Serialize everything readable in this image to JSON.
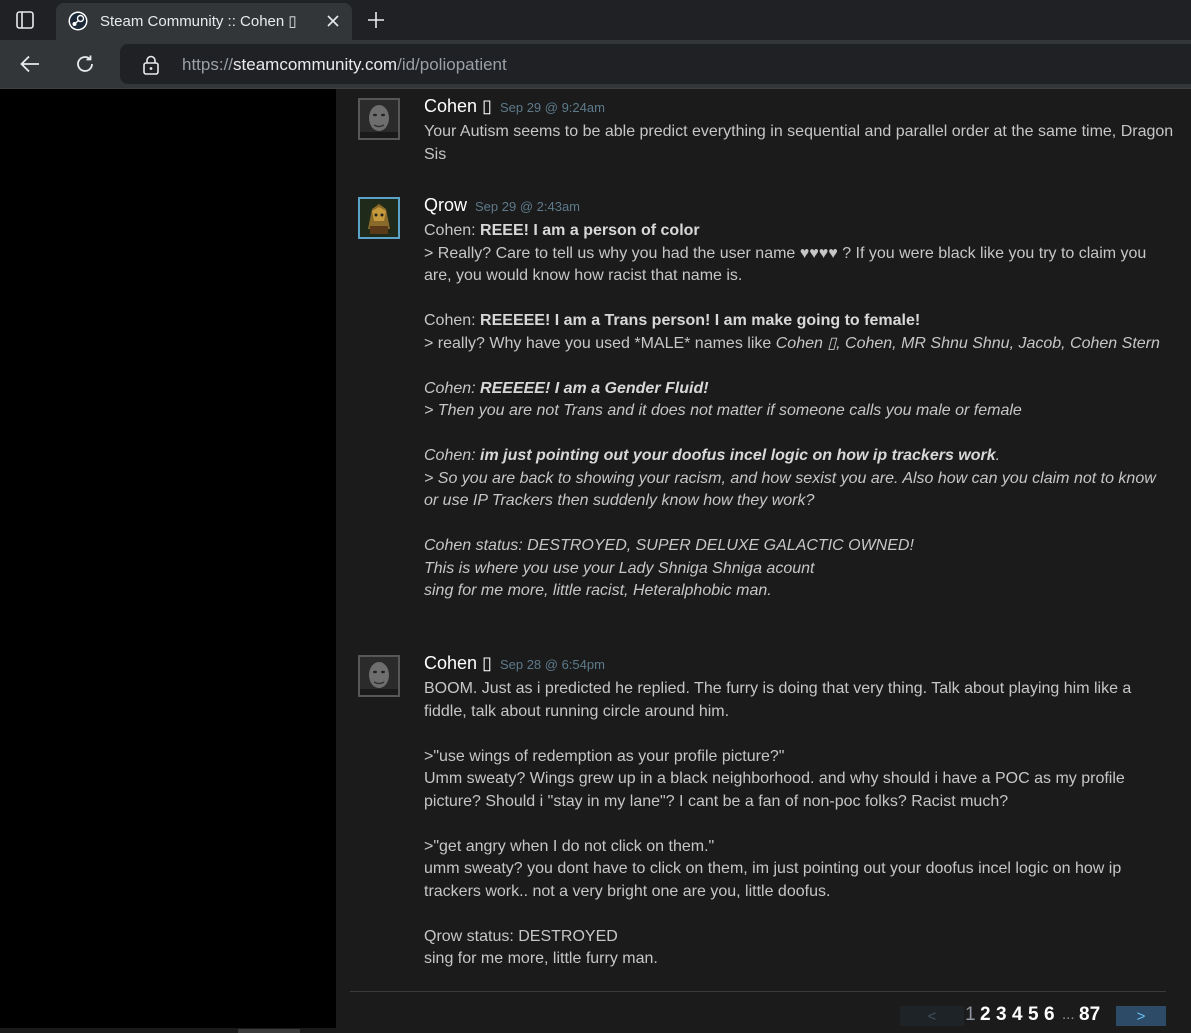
{
  "browser": {
    "tab_title": "Steam Community :: Cohen ▯",
    "url_scheme": "https://",
    "url_host": "steamcommunity.com",
    "url_path": "/id/poliopatient",
    "colors": {
      "tabbar": "#202124",
      "toolbar": "#323639"
    },
    "icons": [
      "sidebar-toggle-icon",
      "steam-logo-icon",
      "close-icon",
      "plus-icon",
      "back-arrow-icon",
      "reload-icon",
      "lock-icon"
    ]
  },
  "comments": [
    {
      "author": "Cohen ▯",
      "time": "Sep 29 @ 9:24am",
      "lines": [
        "Your Autism seems to be able predict everything in sequential and parallel order at the same time, Dragon Sis"
      ]
    },
    {
      "author": "Qrow",
      "time": "Sep 29 @ 2:43am",
      "l1_pre": "Cohen: ",
      "l1_bold": "REEE! I am a person of color",
      "l2": "> Really? Care to tell us why you had the user name ♥♥♥♥ ? If you were black like you try to claim you are, you would know how racist that name is.",
      "l3_pre": "Cohen: ",
      "l3_bold": "REEEEE! I am a Trans person! I am make going to female!",
      "l4_pre": "> really? Why have you used *MALE* names like ",
      "l4_italic": "Cohen ▯, Cohen, MR Shnu Shnu, Jacob, Cohen Stern",
      "l5_pre": "Cohen: ",
      "l5_bold": "REEEEE! I am a Gender Fluid!",
      "l6": "> Then you are not Trans and it does not matter if someone calls you male or female",
      "l7_pre": "Cohen: ",
      "l7_bold": "im just pointing out your doofus incel logic on how ip trackers work",
      "l7_post": ".",
      "l8": "> So you are back to showing your racism, and how sexist you are. Also how can you claim not to know or use IP Trackers then suddenly know how they work?",
      "l9": "Cohen status: DESTROYED, SUPER DELUXE GALACTIC OWNED!",
      "l10": "This is where you use your Lady Shniga Shniga acount",
      "l11": "sing for me more, little racist, Heteralphobic man."
    },
    {
      "author": "Cohen ▯",
      "time": "Sep 28 @ 6:54pm",
      "lines": [
        "BOOM. Just as i predicted he replied. The furry is doing that very thing. Talk about playing him like a fiddle, talk about running circle around him.",
        ">\"use wings of redemption as your profile picture?\"",
        "Umm sweaty? Wings grew up in a black neighborhood. and why should i have a POC as my profile picture? Should i \"stay in my lane\"? I cant be a fan of non-poc folks? Racist much?",
        ">\"get angry when I do not click on them.\"",
        "umm sweaty? you dont have to click on them, im just pointing out your doofus incel logic on how ip trackers work.. not a very bright one are you, little doofus.",
        "Qrow status: DESTROYED",
        "sing for me more, little furry man."
      ]
    }
  ],
  "pagination": {
    "prev": "<",
    "pages": [
      "1",
      "2",
      "3",
      "4",
      "5",
      "6"
    ],
    "current": "1",
    "ellipsis": "...",
    "last": "87",
    "next": ">"
  },
  "colors": {
    "page_bg": "#1b1b1c",
    "timestamp": "#5d7a8a",
    "next_btn": "#2d4b66"
  }
}
